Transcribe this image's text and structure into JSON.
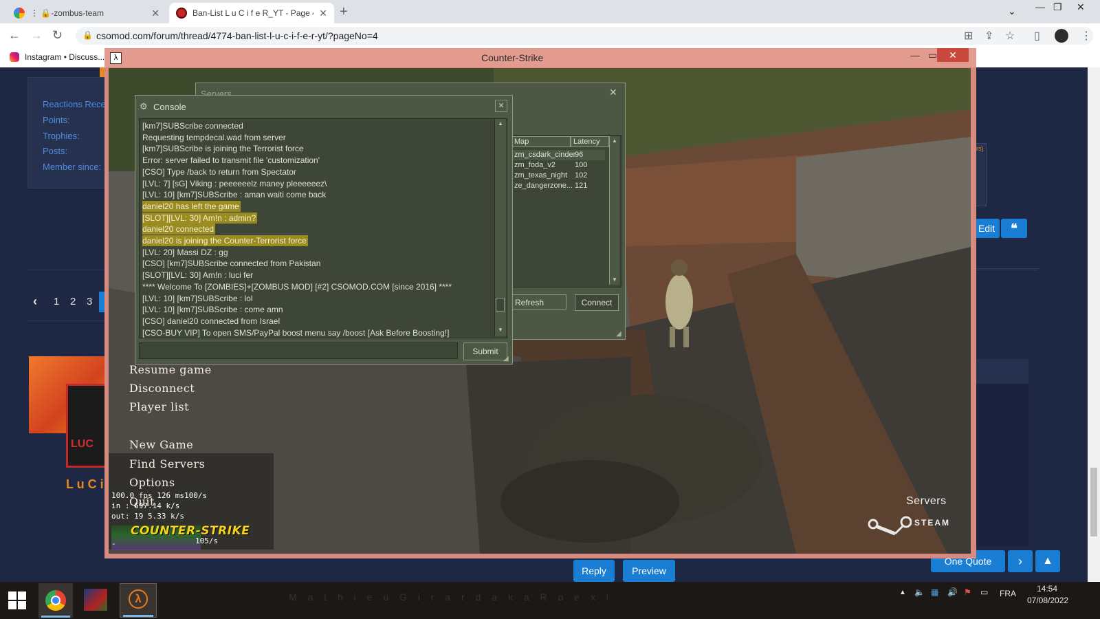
{
  "browser": {
    "tabs": [
      {
        "title": "⋮ 🔒-zombus-team",
        "active": false
      },
      {
        "title": "Ban-List L u C i f e R_YT - Page 4",
        "active": true
      }
    ],
    "url": "csomod.com/forum/thread/4774-ban-list-l-u-c-i-f-e-r-yt/?pageNo=4",
    "bookmarks": [
      "Instagram • Discuss..."
    ]
  },
  "forum": {
    "profile_labels": [
      "Reactions Receiv",
      "Points:",
      "Trophies:",
      "Posts:",
      "Member since:"
    ],
    "pagination": [
      "1",
      "2",
      "3"
    ],
    "username_fragment": "L u C i",
    "avatar_text": "LUC",
    "buttons": {
      "edit": "Edit",
      "one_quote": "One Quote",
      "reply": "Reply",
      "preview": "Preview"
    },
    "j_fragment": "J",
    "rs_fragment": "rs)"
  },
  "cs_window": {
    "title": "Counter-Strike",
    "menu": [
      "Resume game",
      "Disconnect",
      "Player list",
      "New Game",
      "Find Servers",
      "Options",
      "Quit"
    ],
    "netgraph": [
      "100.0 fps  126 ms100/s",
      "in :  697.14 k/s",
      "out:  19 5.33 k/s"
    ],
    "netgraph_rate": "105/s",
    "netgraph_dash": "-",
    "cs_logo": "COUNTER-STRIKE",
    "servers_label": "Servers",
    "steam_label": "STEAM"
  },
  "console": {
    "title": "Console",
    "lines": [
      {
        "text": "[km7]SUBScribe connected",
        "hl": false
      },
      {
        "text": "Requesting tempdecal.wad from server",
        "hl": false
      },
      {
        "text": "[km7]SUBScribe is joining the Terrorist force",
        "hl": false
      },
      {
        "text": "Error: server failed to transmit file 'customization'",
        "hl": false
      },
      {
        "text": "[CSO] Type /back to return from Spectator",
        "hl": false
      },
      {
        "text": "[LVL: 7] [sG] Viking : peeeeeelz maney pleeeeeez\\",
        "hl": false
      },
      {
        "text": "[LVL: 10] [km7]SUBScribe : aman waiti come back",
        "hl": false
      },
      {
        "text": "daniel20 has left the game",
        "hl": true
      },
      {
        "text": "[SLOT][LVL: 30] Am!n : admin?",
        "hl": true
      },
      {
        "text": "daniel20 connected",
        "hl": true
      },
      {
        "text": "daniel20 is joining the Counter-Terrorist force",
        "hl": true
      },
      {
        "text": "[LVL: 20] Massi DZ : gg",
        "hl": false
      },
      {
        "text": "[CSO] [km7]SUBScribe connected from Pakistan",
        "hl": false
      },
      {
        "text": "[SLOT][LVL: 30] Am!n : luci fer",
        "hl": false
      },
      {
        "text": "**** Welcome To [ZOMBIES]+[ZOMBUS MOD] [#2] CSOMOD.COM [since 2016] ****",
        "hl": false
      },
      {
        "text": "[LVL: 10] [km7]SUBScribe : lol",
        "hl": false
      },
      {
        "text": "[LVL: 10] [km7]SUBScribe : come amn",
        "hl": false
      },
      {
        "text": "[CSO] daniel20 connected from Israel",
        "hl": false
      },
      {
        "text": "[CSO-BUY VIP] To open SMS/PayPal boost menu say /boost [Ask Before Boosting!]",
        "hl": false
      }
    ],
    "input_value": "",
    "submit_label": "Submit"
  },
  "servers": {
    "title": "Servers",
    "columns": [
      "Map",
      "Latency"
    ],
    "rows": [
      {
        "map": "zm_csdark_cinder",
        "latency": "96"
      },
      {
        "map": "zm_foda_v2",
        "latency": "100"
      },
      {
        "map": "zm_texas_night",
        "latency": "102"
      },
      {
        "map": "ze_dangerzone...",
        "latency": "121"
      }
    ],
    "refresh_label": "Refresh",
    "connect_label": "Connect"
  },
  "taskbar": {
    "language": "FRA",
    "time": "14:54",
    "date": "07/08/2022",
    "watermark": "M a t h i e u   G i r a r d   a k a   R o e x l"
  },
  "colors": {
    "console_bg": "#3e4637",
    "panel_bg": "#4c5844",
    "highlight": "#9b8c21",
    "window_frame": "#d68a80",
    "forum_bg": "#1e2744",
    "accent_blue": "#1a7fd4"
  }
}
